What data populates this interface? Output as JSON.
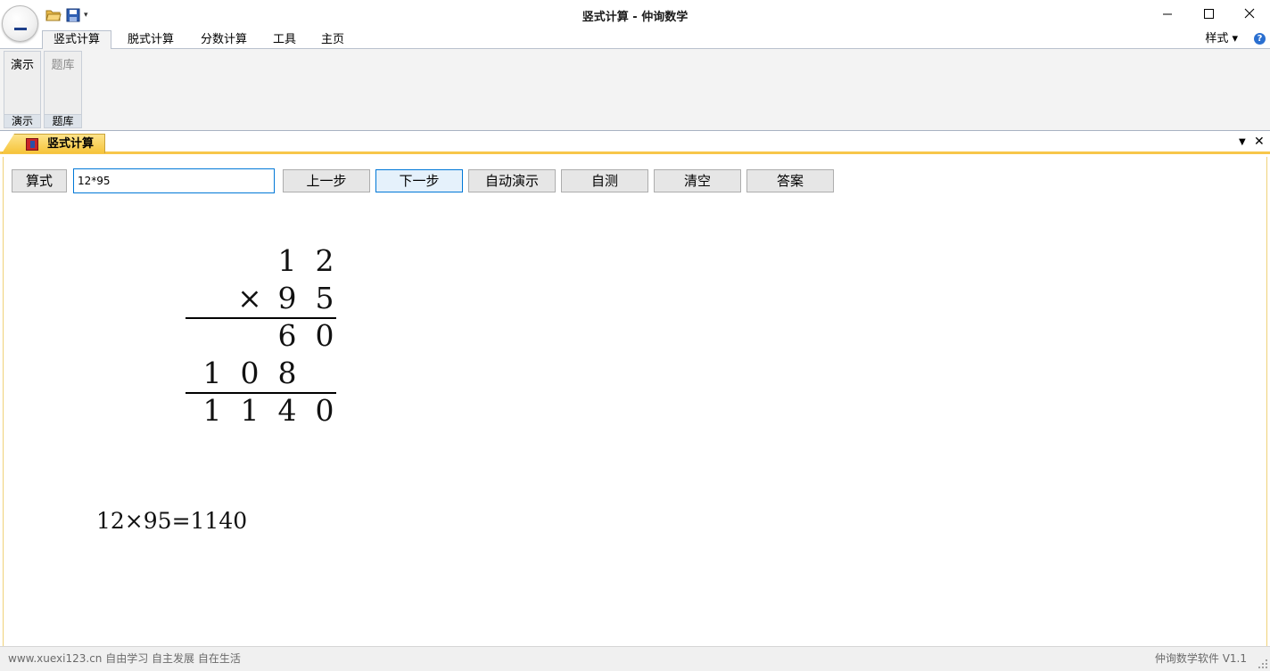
{
  "window": {
    "title": "竖式计算 - 仲询数学",
    "controls": {
      "minimize": "minimize-icon",
      "maximize": "maximize-icon",
      "close": "close-icon"
    }
  },
  "quick_access": {
    "more": "▾"
  },
  "ribbon": {
    "tabs": [
      {
        "label": "竖式计算",
        "active": true
      },
      {
        "label": "脱式计算"
      },
      {
        "label": "分数计算"
      },
      {
        "label": "工具"
      },
      {
        "label": "主页"
      }
    ],
    "style_menu": "样式 ▾",
    "help": "?",
    "groups": [
      {
        "button": "演示",
        "label": "演示"
      },
      {
        "button": "题库",
        "label": "题库"
      }
    ]
  },
  "document": {
    "tab_label": "竖式计算",
    "dropdown": "▼",
    "close": "✕"
  },
  "toolbar": {
    "formula_label": "算式",
    "expression_value": "12*95",
    "prev_label": "上一步",
    "next_label": "下一步",
    "auto_label": "自动演示",
    "test_label": "自测",
    "clear_label": "清空",
    "answer_label": "答案"
  },
  "calculation": {
    "rows": [
      [
        "",
        "",
        "1",
        "2"
      ],
      [
        "",
        "×",
        "9",
        "5"
      ],
      [
        "",
        "",
        "6",
        "0"
      ],
      [
        "1",
        "0",
        "8",
        ""
      ],
      [
        "1",
        "1",
        "4",
        "0"
      ]
    ],
    "equation": "12×95=1140"
  },
  "status": {
    "left": "www.xuexi123.cn 自由学习 自主发展 自在生活",
    "right": "仲询数学软件 V1.1"
  },
  "colors": {
    "accent": "#0078d7",
    "doc_tab": "#f6c43a",
    "status_text": "#6a6a6a"
  }
}
